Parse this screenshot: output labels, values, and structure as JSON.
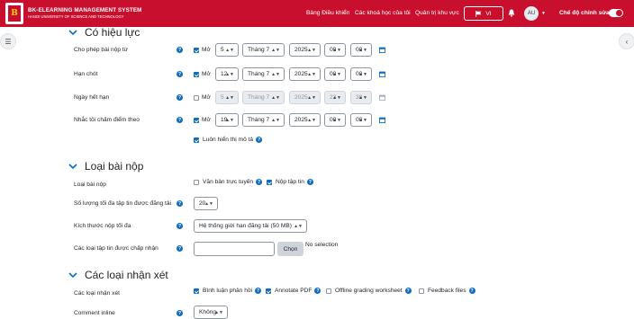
{
  "header": {
    "brand_line1": "BK-ELEARNING MANAGEMENT SYSTEM",
    "brand_line2": "HANOI UNIVERSITY OF SCIENCE AND TECHNOLOGY",
    "logo_text": "B",
    "nav": [
      "Bảng Điều khiển",
      "Các khoá học của tôi",
      "Quản trị khu vực"
    ],
    "language": "VI",
    "avatar_initials": "AU",
    "edit_mode_label": "Chế độ chỉnh sửa",
    "edit_mode_on": true,
    "brand_color": "#c8102e"
  },
  "availability": {
    "title": "Có hiệu lực",
    "rows": [
      {
        "label": "Cho phép bài nộp từ",
        "enabled": true,
        "enable_label": "Mở",
        "day": "5",
        "month": "Tháng 7",
        "year": "2025",
        "hour": "00",
        "minute": "00"
      },
      {
        "label": "Hạn chót",
        "enabled": true,
        "enable_label": "Mở",
        "day": "12",
        "month": "Tháng 7",
        "year": "2025",
        "hour": "00",
        "minute": "00"
      },
      {
        "label": "Ngày hết hạn",
        "enabled": false,
        "enable_label": "Mở",
        "day": "5",
        "month": "Tháng 7",
        "year": "2025",
        "hour": "23",
        "minute": "38"
      },
      {
        "label": "Nhắc tôi chấm điểm theo",
        "enabled": true,
        "enable_label": "Mở",
        "day": "19",
        "month": "Tháng 7",
        "year": "2025",
        "hour": "00",
        "minute": "00"
      }
    ],
    "always_show_description": "Luôn hiển thị mô tả"
  },
  "submission_types": {
    "title": "Loại bài nộp",
    "type_label": "Loại bài nộp",
    "online_text": "Văn bản trực tuyến",
    "online_text_checked": false,
    "file_submissions": "Nộp tập tin",
    "file_submissions_checked": true,
    "max_files_label": "Số lượng tối đa tập tin được đăng tải",
    "max_files_value": "20",
    "max_size_label": "Kích thước nộp tối đa",
    "max_size_value": "Hệ thống giới hạn đăng tải (50 MB)",
    "accepted_types_label": "Các loại tập tin được chấp nhận",
    "choose_button": "Chọn",
    "no_selection": "No selection"
  },
  "feedback_types": {
    "title": "Các loại nhận xét",
    "types_label": "Các loại nhận xét",
    "options": [
      {
        "label": "Bình luận phản hồi",
        "checked": true
      },
      {
        "label": "Annotate PDF",
        "checked": true
      },
      {
        "label": "Offline grading worksheet",
        "checked": false
      },
      {
        "label": "Feedback files",
        "checked": false
      }
    ],
    "comment_inline_label": "Comment inline",
    "comment_inline_value": "Không"
  }
}
